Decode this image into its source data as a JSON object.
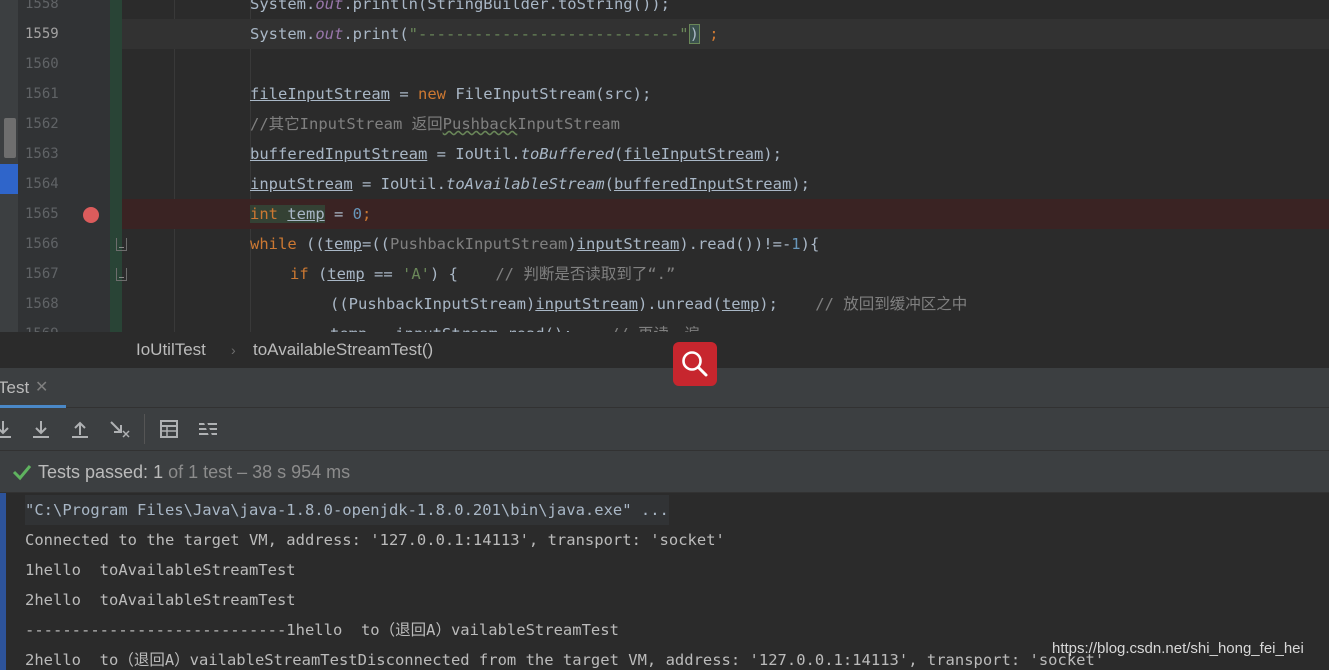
{
  "editor": {
    "lines": [
      {
        "num": "1558",
        "id": "l1558"
      },
      {
        "num": "1559",
        "id": "l1559"
      },
      {
        "num": "1560",
        "id": "l1560"
      },
      {
        "num": "1561",
        "id": "l1561"
      },
      {
        "num": "1562",
        "id": "l1562"
      },
      {
        "num": "1563",
        "id": "l1563"
      },
      {
        "num": "1564",
        "id": "l1564"
      },
      {
        "num": "1565",
        "id": "l1565"
      },
      {
        "num": "1566",
        "id": "l1566"
      },
      {
        "num": "1567",
        "id": "l1567"
      },
      {
        "num": "1568",
        "id": "l1568"
      },
      {
        "num": "1569",
        "id": "l1569"
      }
    ],
    "code": {
      "l1559_a": "System.",
      "l1559_b": "out",
      "l1559_c": ".print(",
      "l1559_d": "\"----------------------------\"",
      "l1559_e": ")",
      "l1559_f": " ;",
      "l1561_a": "fileInputStream",
      "l1561_b": " = ",
      "l1561_c": "new",
      "l1561_d": " FileInputStream(src);",
      "l1562_a": "//其它InputStream 返回",
      "l1562_b": "Pushback",
      "l1562_c": "InputStream",
      "l1563_a": "bufferedInputStream",
      "l1563_b": " = IoUtil.",
      "l1563_c": "toBuffered",
      "l1563_d": "(",
      "l1563_e": "fileInputStream",
      "l1563_f": ");",
      "l1564_a": "inputStream",
      "l1564_b": " = IoUtil.",
      "l1564_c": "toAvailableStream",
      "l1564_d": "(",
      "l1564_e": "bufferedInputStream",
      "l1564_f": ");",
      "l1565_a": "int",
      "l1565_b": " ",
      "l1565_c": "temp",
      "l1565_d": " = ",
      "l1565_e": "0",
      "l1565_f": ";",
      "l1566_a": "while",
      "l1566_b": " ((",
      "l1566_c": "temp",
      "l1566_d": "=((",
      "l1566_e": "PushbackInputStream",
      "l1566_f": ")",
      "l1566_g": "inputStream",
      "l1566_h": ").read())!=-",
      "l1566_i": "1",
      "l1566_j": "){",
      "l1567_a": "if",
      "l1567_b": " (",
      "l1567_c": "temp",
      "l1567_d": " == ",
      "l1567_e": "'A'",
      "l1567_f": ") {    ",
      "l1567_g": "// 判断是否读取到了“.”",
      "l1568_a": "((PushbackInputStream)",
      "l1568_b": "inputStream",
      "l1568_c": ").unread(",
      "l1568_d": "temp",
      "l1568_e": ");    ",
      "l1568_f": "// 放回到缓冲区之中"
    }
  },
  "breadcrumb": {
    "class": "IoUtilTest",
    "separator": "›",
    "method": "toAvailableStreamTest()"
  },
  "run": {
    "tab_label": "Test",
    "tab_close": "✕",
    "status": {
      "passed_label": "Tests passed: ",
      "passed_count": "1",
      "rest": " of 1 test – 38 s 954 ms"
    },
    "console": [
      "\"C:\\Program Files\\Java\\java-1.8.0-openjdk-1.8.0.201\\bin\\java.exe\" ...",
      "Connected to the target VM, address: '127.0.0.1:14113', transport: 'socket'",
      "1hello  toAvailableStreamTest",
      "2hello  toAvailableStreamTest",
      "----------------------------1hello  to（退回A）vailableStreamTest",
      "2hello  to（退回A）vailableStreamTestDisconnected from the target VM, address: '127.0.0.1:14113', transport: 'socket'"
    ]
  },
  "watermark": "https://blog.csdn.net/shi_hong_fei_hei",
  "colors": {
    "keyword": "#cc7832",
    "string": "#6a8759",
    "number": "#6897bb",
    "comment": "#808080",
    "field": "#9876aa",
    "pass": "#5fb35f",
    "breakpoint": "#db5c5c"
  },
  "icons": [
    "breakpoint-icon",
    "fold-icon",
    "search-icon",
    "check-icon",
    "rerun-icon",
    "scroll-down-icon",
    "scroll-up-icon",
    "clear-icon",
    "table-icon",
    "filter-icon",
    "close-icon"
  ]
}
